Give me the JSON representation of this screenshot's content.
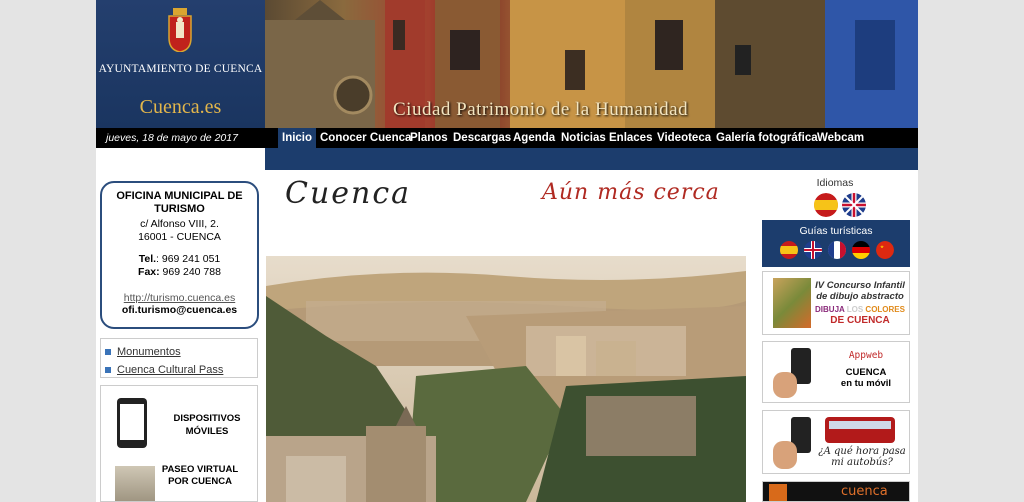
{
  "header": {
    "council_name": "AYUNTAMIENTO DE CUENCA",
    "site_name": "Cuenca.es",
    "tagline": "Ciudad Patrimonio de la Humanidad"
  },
  "date": "jueves, 18 de mayo de 2017",
  "nav": {
    "items": [
      {
        "label": "Inicio",
        "active": true
      },
      {
        "label": "Conocer Cuenca"
      },
      {
        "label": "Planos"
      },
      {
        "label": "Descargas"
      },
      {
        "label": "Agenda"
      },
      {
        "label": "Noticias"
      },
      {
        "label": "Enlaces"
      },
      {
        "label": "Videoteca"
      },
      {
        "label": "Galería fotográfica"
      },
      {
        "label": "Webcam"
      }
    ]
  },
  "tourism": {
    "title": "OFICINA MUNICIPAL DE TURISMO",
    "address_1": "c/ Alfonso VIII, 2.",
    "address_2": "16001 - CUENCA",
    "tel_label": "Tel.",
    "tel": ": 969 241 051",
    "fax_label": "Fax:",
    "fax": " 969 240 788",
    "url": "http://turismo.cuenca.es",
    "email": "ofi.turismo@cuenca.es"
  },
  "links": [
    "Monumentos",
    "Cuenca Cultural Pass"
  ],
  "promo": {
    "devices": "DISPOSITIVOS MÓVILES",
    "walk_1": "PASEO VIRTUAL",
    "walk_2": "POR CUENCA"
  },
  "center": {
    "title": "Cuenca",
    "slogan": "Aún más cerca"
  },
  "right": {
    "languages_title": "Idiomas",
    "guides_title": "Guías turísticas",
    "contest_1": "IV Concurso Infantil",
    "contest_2": "de dibujo abstracto",
    "contest_3a": "DIBUJA",
    "contest_3b": "LOS",
    "contest_3c": "COLORES",
    "contest_4a": "DE",
    "contest_4b": "CUENCA",
    "app_1": "Appweb",
    "app_2": "CUENCA",
    "app_3": "en tu móvil",
    "bus_1": "¿A qué hora pasa",
    "bus_2": "mi autobús?",
    "bottom_logo": "cuenca"
  },
  "colors": {
    "navy": "#1c3d6d",
    "gold": "#e3b64b",
    "slogan_red": "#b02a22"
  }
}
